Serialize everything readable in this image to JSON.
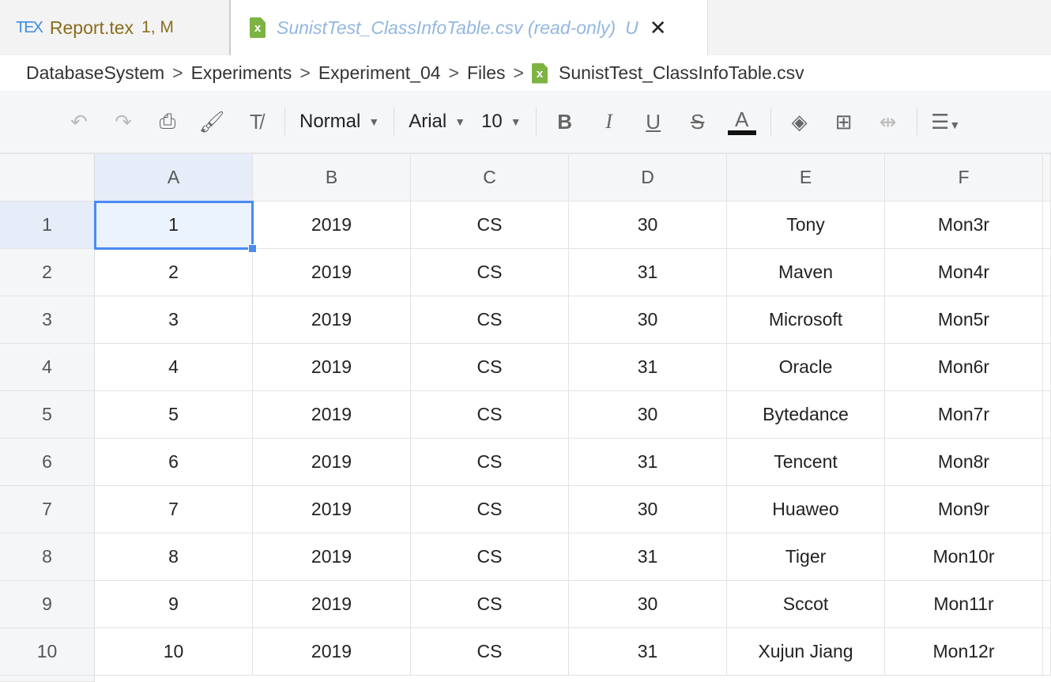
{
  "tabs": [
    {
      "icon": "tex-icon",
      "label": "Report.tex",
      "status": "1, M"
    },
    {
      "icon": "csv-file-icon",
      "label": "SunistTest_ClassInfoTable.csv (read-only)",
      "status": "U",
      "close": "✕"
    }
  ],
  "breadcrumb": [
    "DatabaseSystem",
    "Experiments",
    "Experiment_04",
    "Files",
    "SunistTest_ClassInfoTable.csv"
  ],
  "toolbar": {
    "style": "Normal",
    "font": "Arial",
    "size": "10"
  },
  "columns": [
    "A",
    "B",
    "C",
    "D",
    "E",
    "F"
  ],
  "rows": [
    [
      "1",
      "2019",
      "CS",
      "30",
      "Tony",
      "Mon3r"
    ],
    [
      "2",
      "2019",
      "CS",
      "31",
      "Maven",
      "Mon4r"
    ],
    [
      "3",
      "2019",
      "CS",
      "30",
      "Microsoft",
      "Mon5r"
    ],
    [
      "4",
      "2019",
      "CS",
      "31",
      "Oracle",
      "Mon6r"
    ],
    [
      "5",
      "2019",
      "CS",
      "30",
      "Bytedance",
      "Mon7r"
    ],
    [
      "6",
      "2019",
      "CS",
      "31",
      "Tencent",
      "Mon8r"
    ],
    [
      "7",
      "2019",
      "CS",
      "30",
      "Huaweo",
      "Mon9r"
    ],
    [
      "8",
      "2019",
      "CS",
      "31",
      "Tiger",
      "Mon10r"
    ],
    [
      "9",
      "2019",
      "CS",
      "30",
      "Sccot",
      "Mon11r"
    ],
    [
      "10",
      "2019",
      "CS",
      "31",
      "Xujun Jiang",
      "Mon12r"
    ]
  ],
  "selected_cell": "A1"
}
